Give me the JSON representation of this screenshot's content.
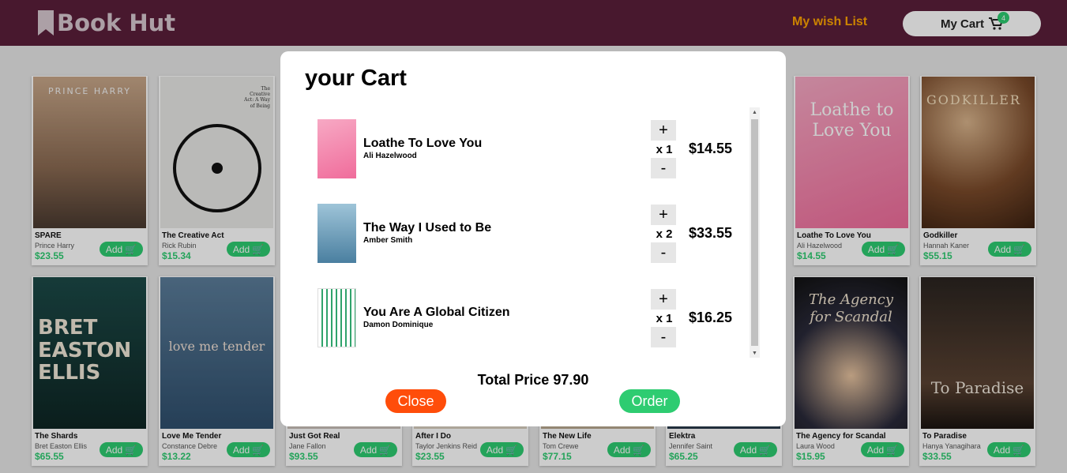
{
  "nav": {
    "brand": "Book Hut",
    "wishlist_label": "My wish List",
    "cart_label": "My Cart",
    "cart_count": "4"
  },
  "colors": {
    "nav_bg": "#5a1f3a",
    "accent_green": "#2ecc71",
    "close_red": "#ff4d0a",
    "wishlist_orange": "#ffa400"
  },
  "books": [
    {
      "title": "SPARE",
      "author": "Prince Harry",
      "price": "$23.55",
      "add_label": "Add",
      "cover_text": "PRINCE HARRY"
    },
    {
      "title": "The Creative Act",
      "author": "Rick Rubin",
      "price": "$15.34",
      "add_label": "Add",
      "cover_text": "The Creative Act: A Way of Being"
    },
    {
      "title": "Just Got Real",
      "author": "Jane Fallon",
      "price": "$93.55",
      "add_label": "Add",
      "cover_text": ""
    },
    {
      "title": "After I Do",
      "author": "Taylor Jenkins Reid",
      "price": "$23.55",
      "add_label": "Add",
      "cover_text": ""
    },
    {
      "title": "The New Life",
      "author": "Tom Crewe",
      "price": "$77.15",
      "add_label": "Add",
      "cover_text": ""
    },
    {
      "title": "Elektra",
      "author": "Jennifer Saint",
      "price": "$65.25",
      "add_label": "Add",
      "cover_text": ""
    },
    {
      "title": "Loathe To Love You",
      "author": "Ali Hazelwood",
      "price": "$14.55",
      "add_label": "Add",
      "cover_text": "Loathe to Love You"
    },
    {
      "title": "Godkiller",
      "author": "Hannah Kaner",
      "price": "$55.15",
      "add_label": "Add",
      "cover_text": "GODKILLER"
    },
    {
      "title": "The Shards",
      "author": "Bret Easton Ellis",
      "price": "$65.55",
      "add_label": "Add",
      "cover_text": "BRET EASTON ELLIS"
    },
    {
      "title": "Love Me Tender",
      "author": "Constance Debre",
      "price": "$13.22",
      "add_label": "Add",
      "cover_text": "love me tender"
    },
    {
      "title": "The Agency for Scandal",
      "author": "Laura Wood",
      "price": "$15.95",
      "add_label": "Add",
      "cover_text": "The Agency for Scandal"
    },
    {
      "title": "To Paradise",
      "author": "Hanya Yanagihara",
      "price": "$33.55",
      "add_label": "Add",
      "cover_text": "To Paradise"
    }
  ],
  "cart": {
    "title": "your Cart",
    "items": [
      {
        "name": "Loathe To Love You",
        "author": "Ali Hazelwood",
        "qty": "x 1",
        "price": "$14.55",
        "plus": "+",
        "minus": "-"
      },
      {
        "name": "The Way I Used to Be",
        "author": "Amber Smith",
        "qty": "x 2",
        "price": "$33.55",
        "plus": "+",
        "minus": "-"
      },
      {
        "name": "You Are A Global Citizen",
        "author": "Damon Dominique",
        "qty": "x 1",
        "price": "$16.25",
        "plus": "+",
        "minus": "-"
      }
    ],
    "total": "Total Price 97.90",
    "close_label": "Close",
    "order_label": "Order"
  }
}
